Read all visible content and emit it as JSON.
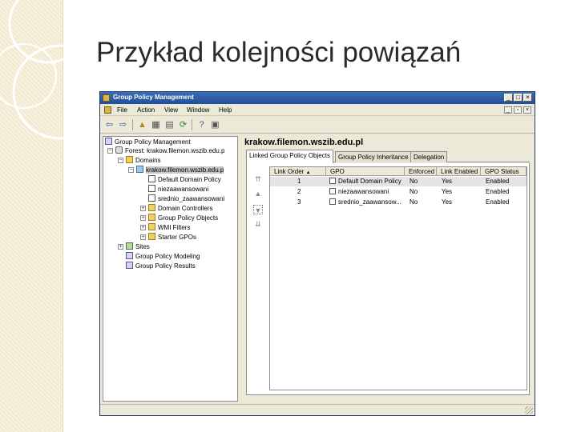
{
  "slide": {
    "title": "Przykład kolejności powiązań"
  },
  "window": {
    "title": "Group Policy Management",
    "menu": [
      "File",
      "Action",
      "View",
      "Window",
      "Help"
    ],
    "tree": [
      {
        "label": "Group Policy Management",
        "icon": "gpm-icon"
      },
      {
        "label": "Forest: krakow.filemon.wszib.edu.p",
        "icon": "forest-icon"
      },
      {
        "label": "Domains",
        "icon": "folder-icon"
      },
      {
        "label": "krakow.filemon.wszib.edu.p",
        "icon": "domain-icon"
      },
      {
        "label": "Default Domain Policy",
        "icon": "gpo-link-icon"
      },
      {
        "label": "niezaawansowani",
        "icon": "gpo-link-icon"
      },
      {
        "label": "srednio_zaawansowani",
        "icon": "gpo-link-icon"
      },
      {
        "label": "Domain Controllers",
        "icon": "folder-icon"
      },
      {
        "label": "Group Policy Objects",
        "icon": "folder-icon"
      },
      {
        "label": "WMI Filters",
        "icon": "folder-icon"
      },
      {
        "label": "Starter GPOs",
        "icon": "folder-icon"
      },
      {
        "label": "Sites",
        "icon": "sites-icon"
      },
      {
        "label": "Group Policy Modeling",
        "icon": "modeling-icon"
      },
      {
        "label": "Group Policy Results",
        "icon": "results-icon"
      }
    ],
    "right": {
      "heading": "krakow.filemon.wszib.edu.pl",
      "tabs": [
        "Linked Group Policy Objects",
        "Group Policy Inheritance",
        "Delegation"
      ],
      "columns": [
        "Link Order",
        "GPO",
        "Enforced",
        "Link Enabled",
        "GPO Status"
      ],
      "rows": [
        {
          "order": "1",
          "gpo": "Default Domain Policy",
          "enforced": "No",
          "link_enabled": "Yes",
          "status": "Enabled"
        },
        {
          "order": "2",
          "gpo": "niezaawansowani",
          "enforced": "No",
          "link_enabled": "Yes",
          "status": "Enabled"
        },
        {
          "order": "3",
          "gpo": "srednio_zaawansow...",
          "enforced": "No",
          "link_enabled": "Yes",
          "status": "Enabled"
        }
      ]
    }
  }
}
